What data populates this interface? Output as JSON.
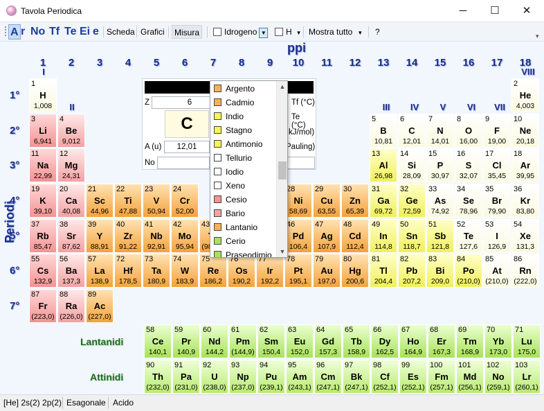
{
  "window": {
    "title": "Tavola Periodica",
    "minimize": "─",
    "maximize": "☐",
    "close": "✕"
  },
  "toolbar": {
    "format_buttons": [
      "A",
      "r",
      "No",
      "Tf",
      "Te",
      "Ei",
      "e"
    ],
    "scheda": "Scheda",
    "grafici": "Grafici",
    "misura": "Misura",
    "element_selector": "Idrogeno",
    "symbol_selector": "H",
    "filter": "Mostra tutto",
    "help": "?",
    "overflow": "▾"
  },
  "headers": {
    "gruppi": "ppi",
    "periodi": "Periodi",
    "groups": [
      "1",
      "2",
      "3",
      "4",
      "5",
      "6",
      "7",
      "8",
      "9",
      "10",
      "11",
      "12",
      "13",
      "14",
      "15",
      "16",
      "17",
      "18"
    ],
    "roman": {
      "i": "I",
      "ii": "II",
      "iii": "III",
      "iv": "IV",
      "v": "V",
      "vi": "VI",
      "vii": "VII",
      "viii": "VIII"
    },
    "periods": [
      "1°",
      "2°",
      "3°",
      "4°",
      "5°",
      "6°",
      "7°"
    ],
    "lantanidi": "Lantanidi",
    "attinidi": "Attinidi"
  },
  "info_panel": {
    "z_label": "Z",
    "z_value": "6",
    "symbol": "C",
    "a_label": "A (u)",
    "a_value": "12,01",
    "no_label": "No",
    "tf": "Tf (°C)",
    "te": "Te (°C)",
    "ei": "kJ/mol)",
    "en": "Pauling)"
  },
  "dropdown": {
    "items": [
      {
        "label": "Argento",
        "color": "#f7b15a"
      },
      {
        "label": "Cadmio",
        "color": "#f7b15a"
      },
      {
        "label": "Indio",
        "color": "#f5f55a"
      },
      {
        "label": "Stagno",
        "color": "#f5f55a"
      },
      {
        "label": "Antimonio",
        "color": "#f5f55a"
      },
      {
        "label": "Tellurio",
        "color": "#ffffff"
      },
      {
        "label": "Iodio",
        "color": "#ffffff"
      },
      {
        "label": "Xeno",
        "color": "#ffffff"
      },
      {
        "label": "Cesio",
        "color": "#f49393"
      },
      {
        "label": "Bario",
        "color": "#f4a2a2"
      },
      {
        "label": "Lantanio",
        "color": "#f7b15a"
      },
      {
        "label": "Cerio",
        "color": "#a8e25a"
      },
      {
        "label": "Praseodimio",
        "color": "#a8e25a"
      }
    ],
    "scroll_up": "▲",
    "scroll_down": "▼"
  },
  "status": {
    "config": "[He] 2s(2) 2p(2)",
    "struttura": "Esagonale",
    "carattere": "Acido"
  },
  "elements": [
    [
      "1",
      "H",
      "1,008",
      1,
      1,
      "nm"
    ],
    [
      "2",
      "He",
      "4,003",
      18,
      1,
      "nm"
    ],
    [
      "3",
      "Li",
      "6,941",
      1,
      2,
      "alk"
    ],
    [
      "4",
      "Be",
      "9,012",
      2,
      2,
      "al"
    ],
    [
      "5",
      "B",
      "10,81",
      13,
      2,
      "nm"
    ],
    [
      "6",
      "C",
      "12,01",
      14,
      2,
      "nm"
    ],
    [
      "7",
      "N",
      "14,01",
      15,
      2,
      "nm"
    ],
    [
      "8",
      "O",
      "16,00",
      16,
      2,
      "nm"
    ],
    [
      "9",
      "F",
      "19,00",
      17,
      2,
      "nm"
    ],
    [
      "10",
      "Ne",
      "20,18",
      18,
      2,
      "nm"
    ],
    [
      "11",
      "Na",
      "22,99",
      1,
      3,
      "alk"
    ],
    [
      "12",
      "Mg",
      "24,31",
      2,
      3,
      "al"
    ],
    [
      "13",
      "Al",
      "26,98",
      13,
      3,
      "pt"
    ],
    [
      "14",
      "Si",
      "28,09",
      14,
      3,
      "nm"
    ],
    [
      "15",
      "P",
      "30,97",
      15,
      3,
      "nm"
    ],
    [
      "16",
      "S",
      "32,07",
      16,
      3,
      "nm"
    ],
    [
      "17",
      "Cl",
      "35,45",
      17,
      3,
      "nm"
    ],
    [
      "18",
      "Ar",
      "39,95",
      18,
      3,
      "nm"
    ],
    [
      "19",
      "K",
      "39,10",
      1,
      4,
      "alk"
    ],
    [
      "20",
      "Ca",
      "40,08",
      2,
      4,
      "al"
    ],
    [
      "21",
      "Sc",
      "44,96",
      3,
      4,
      "tr"
    ],
    [
      "22",
      "Ti",
      "47,88",
      4,
      4,
      "tr"
    ],
    [
      "23",
      "V",
      "50,94",
      5,
      4,
      "tr"
    ],
    [
      "24",
      "Cr",
      "52,00",
      6,
      4,
      "tr"
    ],
    [
      "28",
      "Ni",
      "58,69",
      10,
      4,
      "tr"
    ],
    [
      "29",
      "Cu",
      "63,55",
      11,
      4,
      "tr"
    ],
    [
      "30",
      "Zn",
      "65,39",
      12,
      4,
      "tr"
    ],
    [
      "31",
      "Ga",
      "69,72",
      13,
      4,
      "pt"
    ],
    [
      "32",
      "Ge",
      "72,59",
      14,
      4,
      "pt"
    ],
    [
      "33",
      "As",
      "74,92",
      15,
      4,
      "nm"
    ],
    [
      "34",
      "Se",
      "78,96",
      16,
      4,
      "nm"
    ],
    [
      "35",
      "Br",
      "79,90",
      17,
      4,
      "nm"
    ],
    [
      "36",
      "Kr",
      "83,80",
      18,
      4,
      "nm"
    ],
    [
      "37",
      "Rb",
      "85,47",
      1,
      5,
      "alk"
    ],
    [
      "38",
      "Sr",
      "87,62",
      2,
      5,
      "al"
    ],
    [
      "39",
      "Y",
      "88,91",
      3,
      5,
      "tr"
    ],
    [
      "40",
      "Zr",
      "91,22",
      4,
      5,
      "tr"
    ],
    [
      "41",
      "Nb",
      "92,91",
      5,
      5,
      "tr"
    ],
    [
      "42",
      "Mo",
      "95,94",
      6,
      5,
      "tr"
    ],
    [
      "43",
      "Tc",
      "(98,91)",
      7,
      5,
      "tr"
    ],
    [
      "44",
      "Ru",
      "101,1",
      8,
      5,
      "tr"
    ],
    [
      "45",
      "Rh",
      "102,9",
      9,
      5,
      "tr"
    ],
    [
      "46",
      "Pd",
      "106,4",
      10,
      5,
      "tr"
    ],
    [
      "47",
      "Ag",
      "107,9",
      11,
      5,
      "tr"
    ],
    [
      "48",
      "Cd",
      "112,4",
      12,
      5,
      "tr"
    ],
    [
      "49",
      "In",
      "114,8",
      13,
      5,
      "pt"
    ],
    [
      "50",
      "Sn",
      "118,7",
      14,
      5,
      "pt"
    ],
    [
      "51",
      "Sb",
      "121,8",
      15,
      5,
      "pt"
    ],
    [
      "52",
      "Te",
      "127,6",
      16,
      5,
      "nm"
    ],
    [
      "53",
      "I",
      "126,9",
      17,
      5,
      "nm"
    ],
    [
      "54",
      "Xe",
      "131,3",
      18,
      5,
      "nm"
    ],
    [
      "55",
      "Cs",
      "132,9",
      1,
      6,
      "alk"
    ],
    [
      "56",
      "Ba",
      "137,3",
      2,
      6,
      "al"
    ],
    [
      "57",
      "La",
      "138,9",
      3,
      6,
      "tr"
    ],
    [
      "72",
      "Hf",
      "178,5",
      4,
      6,
      "tr"
    ],
    [
      "73",
      "Ta",
      "180,9",
      5,
      6,
      "tr"
    ],
    [
      "74",
      "W",
      "183,9",
      6,
      6,
      "tr"
    ],
    [
      "75",
      "Re",
      "186,2",
      7,
      6,
      "tr"
    ],
    [
      "76",
      "Os",
      "190,2",
      8,
      6,
      "tr"
    ],
    [
      "77",
      "Ir",
      "192,2",
      9,
      6,
      "tr"
    ],
    [
      "78",
      "Pt",
      "195,1",
      10,
      6,
      "tr"
    ],
    [
      "79",
      "Au",
      "197,0",
      11,
      6,
      "tr"
    ],
    [
      "80",
      "Hg",
      "200,6",
      12,
      6,
      "tr"
    ],
    [
      "81",
      "Tl",
      "204,4",
      13,
      6,
      "pt"
    ],
    [
      "82",
      "Pb",
      "207,2",
      14,
      6,
      "pt"
    ],
    [
      "83",
      "Bi",
      "209,0",
      15,
      6,
      "pt"
    ],
    [
      "84",
      "Po",
      "(210,0)",
      16,
      6,
      "pt"
    ],
    [
      "85",
      "At",
      "(210,0)",
      17,
      6,
      "nm"
    ],
    [
      "86",
      "Rn",
      "(222,0)",
      18,
      6,
      "nm"
    ],
    [
      "87",
      "Fr",
      "(223,0)",
      1,
      7,
      "alk"
    ],
    [
      "88",
      "Ra",
      "(226,0)",
      2,
      7,
      "al"
    ],
    [
      "89",
      "Ac",
      "(227,0)",
      3,
      7,
      "tr"
    ],
    [
      "58",
      "Ce",
      "140,1",
      6,
      9,
      "lan"
    ],
    [
      "59",
      "Pr",
      "140,9",
      7,
      9,
      "lan"
    ],
    [
      "60",
      "Nd",
      "144,2",
      8,
      9,
      "lan"
    ],
    [
      "61",
      "Pm",
      "(144,9)",
      9,
      9,
      "lan"
    ],
    [
      "62",
      "Sm",
      "150,4",
      10,
      9,
      "lan"
    ],
    [
      "63",
      "Eu",
      "152,0",
      11,
      9,
      "lan"
    ],
    [
      "64",
      "Gd",
      "157,3",
      12,
      9,
      "lan"
    ],
    [
      "65",
      "Tb",
      "158,9",
      13,
      9,
      "lan"
    ],
    [
      "66",
      "Dy",
      "162,5",
      14,
      9,
      "lan"
    ],
    [
      "67",
      "Ho",
      "164,9",
      15,
      9,
      "lan"
    ],
    [
      "68",
      "Er",
      "167,3",
      16,
      9,
      "lan"
    ],
    [
      "69",
      "Tm",
      "168,9",
      17,
      9,
      "lan"
    ],
    [
      "70",
      "Yb",
      "173,0",
      18,
      9,
      "lan"
    ],
    [
      "71",
      "Lu",
      "175,0",
      19,
      9,
      "lan"
    ],
    [
      "90",
      "Th",
      "(232,0)",
      6,
      10,
      "act"
    ],
    [
      "91",
      "Pa",
      "(231,0)",
      7,
      10,
      "act"
    ],
    [
      "92",
      "U",
      "(238,0)",
      8,
      10,
      "act"
    ],
    [
      "93",
      "Np",
      "(237,0)",
      9,
      10,
      "act"
    ],
    [
      "94",
      "Pu",
      "(239,1)",
      10,
      10,
      "act"
    ],
    [
      "95",
      "Am",
      "(243,1)",
      11,
      10,
      "act"
    ],
    [
      "96",
      "Cm",
      "(247,1)",
      12,
      10,
      "act"
    ],
    [
      "97",
      "Bk",
      "(247,1)",
      13,
      10,
      "act"
    ],
    [
      "98",
      "Cf",
      "(252,1)",
      14,
      10,
      "act"
    ],
    [
      "99",
      "Es",
      "(252,1)",
      15,
      10,
      "act"
    ],
    [
      "100",
      "Fm",
      "(257,1)",
      16,
      10,
      "act"
    ],
    [
      "101",
      "Md",
      "(256,1)",
      17,
      10,
      "act"
    ],
    [
      "102",
      "No",
      "(259,1)",
      18,
      10,
      "act"
    ],
    [
      "103",
      "Lr",
      "(260,1)",
      19,
      10,
      "act"
    ]
  ]
}
